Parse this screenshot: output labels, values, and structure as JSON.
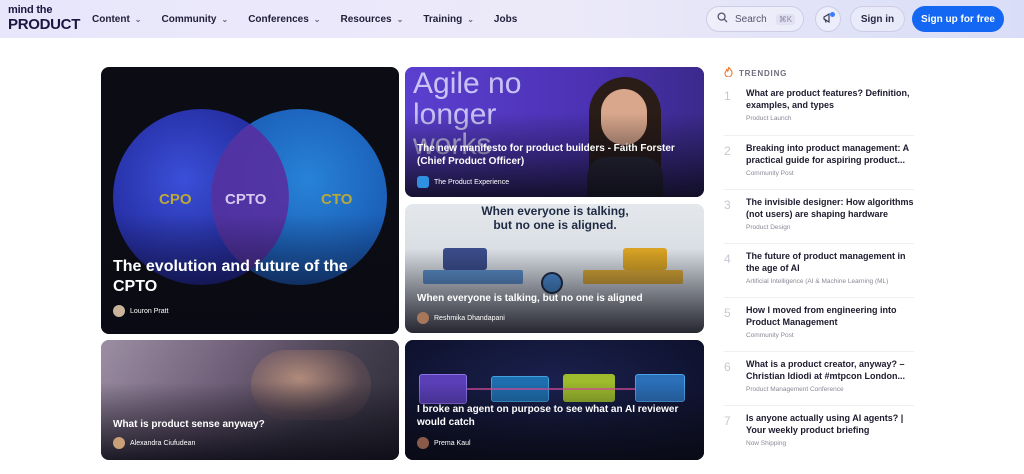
{
  "header": {
    "logo_line1": "mind the",
    "logo_line2": "PRODUCT",
    "nav": [
      {
        "label": "Content",
        "has_dropdown": true
      },
      {
        "label": "Community",
        "has_dropdown": true
      },
      {
        "label": "Conferences",
        "has_dropdown": true
      },
      {
        "label": "Resources",
        "has_dropdown": true
      },
      {
        "label": "Training",
        "has_dropdown": true
      },
      {
        "label": "Jobs",
        "has_dropdown": false
      }
    ],
    "search_placeholder": "Search",
    "search_shortcut": "⌘K",
    "sign_in": "Sign in",
    "sign_up": "Sign up for free"
  },
  "cards": [
    {
      "title": "The evolution and future of the CPTO",
      "author": "Louron Pratt",
      "venn_labels": [
        "CPO",
        "CPTO",
        "CTO"
      ]
    },
    {
      "title": "The new manifesto for product builders - Faith Forster (Chief Product Officer)",
      "author": "The Product Experience",
      "bg_text": "Agile no longer works"
    },
    {
      "title": "When everyone is talking, but no one is aligned",
      "author": "Reshmika Dhandapani",
      "bg_text": "When everyone is talking, but no one is aligned."
    },
    {
      "title": "What is product sense anyway?",
      "author": "Alexandra Ciufudean"
    },
    {
      "title": "I broke an agent on purpose to see what an AI reviewer would catch",
      "author": "Prema Kaul"
    }
  ],
  "trending": {
    "heading": "TRENDING",
    "items": [
      {
        "num": "1",
        "title": "What are product features? Definition, examples, and types",
        "category": "Product Launch"
      },
      {
        "num": "2",
        "title": "Breaking into product management: A practical guide for aspiring product...",
        "category": "Community Post"
      },
      {
        "num": "3",
        "title": "The invisible designer: How algorithms (not users) are shaping hardware",
        "category": "Product Design"
      },
      {
        "num": "4",
        "title": "The future of product management in the age of AI",
        "category": "Artificial Intelligence (AI & Machine Learning (ML)"
      },
      {
        "num": "5",
        "title": "How I moved from engineering into Product Management",
        "category": "Community Post"
      },
      {
        "num": "6",
        "title": "What is a product creator, anyway? – Christian Idiodi at #mtpcon London...",
        "category": "Product Management Conference"
      },
      {
        "num": "7",
        "title": "Is anyone actually using AI agents? | Your weekly product briefing",
        "category": "Now Shipping"
      }
    ]
  },
  "colors": {
    "accent": "#1467f2",
    "header_bg": "#e8e6fb"
  }
}
